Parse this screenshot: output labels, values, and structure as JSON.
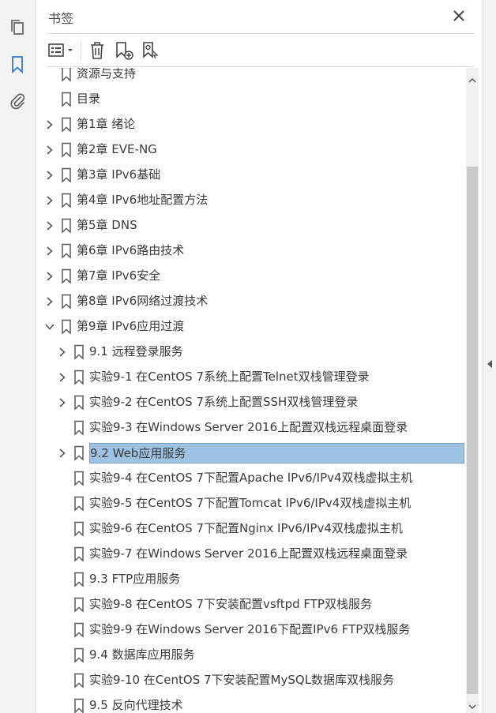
{
  "panel": {
    "title": "书签"
  },
  "toolbar": {
    "options_icon": "options-list-icon",
    "delete_icon": "trash-icon",
    "new_icon": "new-bookmark-icon",
    "props_icon": "bookmark-properties-icon"
  },
  "left_nav": [
    "pages-icon",
    "bookmarks-icon",
    "attachments-icon"
  ],
  "bookmarks": [
    {
      "label": "资源与支持",
      "expander": "none",
      "level": 0
    },
    {
      "label": "目录",
      "expander": "none",
      "level": 0
    },
    {
      "label": "第1章  绪论",
      "expander": "collapsed",
      "level": 0
    },
    {
      "label": "第2章  EVE-NG",
      "expander": "collapsed",
      "level": 0
    },
    {
      "label": "第3章  IPv6基础",
      "expander": "collapsed",
      "level": 0
    },
    {
      "label": "第4章  IPv6地址配置方法",
      "expander": "collapsed",
      "level": 0
    },
    {
      "label": "第5章  DNS",
      "expander": "collapsed",
      "level": 0
    },
    {
      "label": "第6章  IPv6路由技术",
      "expander": "collapsed",
      "level": 0
    },
    {
      "label": "第7章  IPv6安全",
      "expander": "collapsed",
      "level": 0
    },
    {
      "label": "第8章  IPv6网络过渡技术",
      "expander": "collapsed",
      "level": 0
    },
    {
      "label": "第9章  IPv6应用过渡",
      "expander": "expanded",
      "level": 0
    },
    {
      "label": "9.1  远程登录服务",
      "expander": "collapsed",
      "level": 1
    },
    {
      "label": "实验9-1  在CentOS  7系统上配置Telnet双栈管理登录",
      "expander": "collapsed",
      "level": 1
    },
    {
      "label": "实验9-2  在CentOS  7系统上配置SSH双栈管理登录",
      "expander": "collapsed",
      "level": 1
    },
    {
      "label": "实验9-3  在Windows  Server  2016上配置双栈远程桌面登录",
      "expander": "none",
      "level": 1
    },
    {
      "label": "9.2  Web应用服务",
      "expander": "collapsed",
      "level": 1,
      "selected": true
    },
    {
      "label": "实验9-4  在CentOS  7下配置Apache  IPv6/IPv4双栈虚拟主机",
      "expander": "none",
      "level": 1
    },
    {
      "label": "实验9-5  在CentOS  7下配置Tomcat  IPv6/IPv4双栈虚拟主机",
      "expander": "none",
      "level": 1
    },
    {
      "label": "实验9-6  在CentOS  7下配置Nginx  IPv6/IPv4双栈虚拟主机",
      "expander": "none",
      "level": 1
    },
    {
      "label": "实验9-7  在Windows  Server  2016上配置双栈远程桌面登录",
      "expander": "none",
      "level": 1
    },
    {
      "label": "9.3  FTP应用服务",
      "expander": "none",
      "level": 1
    },
    {
      "label": "实验9-8  在CentOS  7下安装配置vsftpd  FTP双栈服务",
      "expander": "none",
      "level": 1
    },
    {
      "label": "实验9-9  在Windows  Server  2016下配置IPv6  FTP双栈服务",
      "expander": "none",
      "level": 1
    },
    {
      "label": "9.4  数据库应用服务",
      "expander": "none",
      "level": 1
    },
    {
      "label": "实验9-10  在CentOS  7下安装配置MySQL数据库双栈服务",
      "expander": "none",
      "level": 1
    },
    {
      "label": "9.5  反向代理技术",
      "expander": "none",
      "level": 1
    }
  ]
}
